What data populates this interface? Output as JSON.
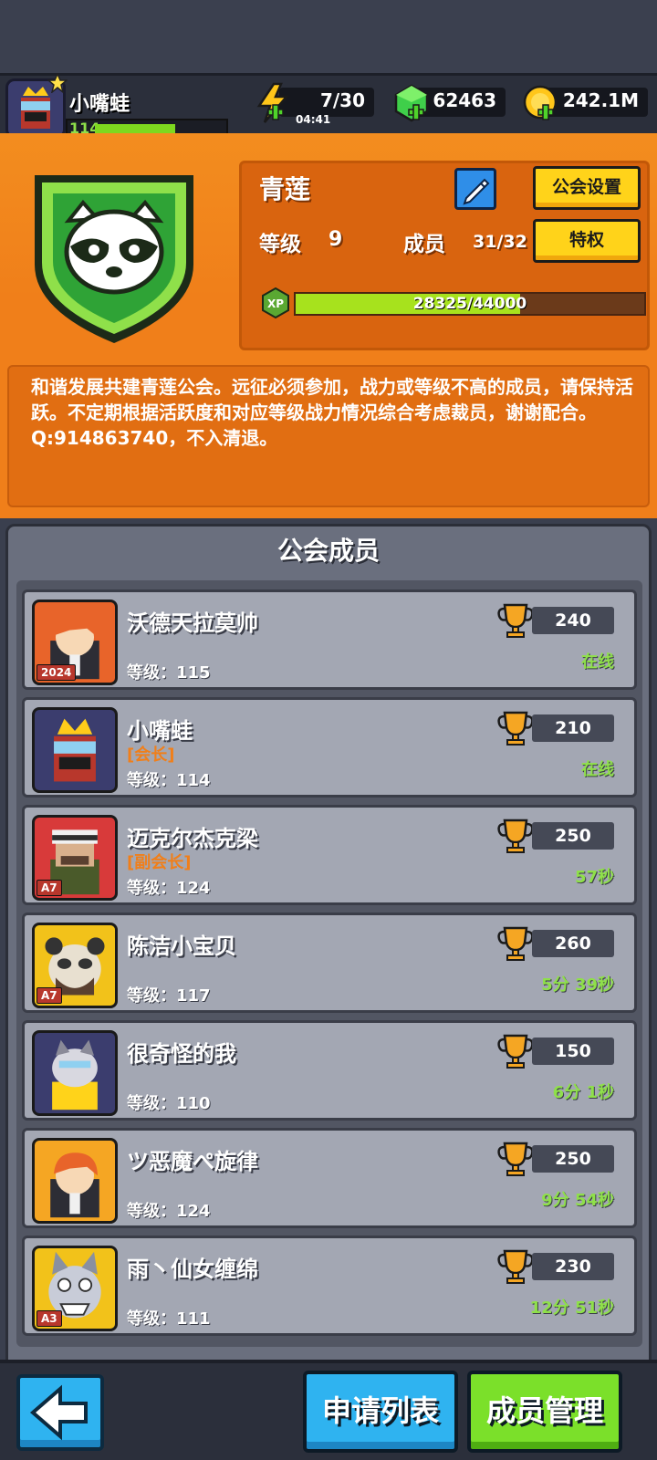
{
  "player": {
    "name": "小嘴蛙",
    "level": "114"
  },
  "resources": {
    "energy": "7/30",
    "energy_timer": "04:41",
    "gems": "62463",
    "coins": "242.1M"
  },
  "guild": {
    "name": "青莲",
    "settings_label": "公会设置",
    "privilege_label": "特权",
    "level_label": "等级",
    "level_value": "9",
    "members_label": "成员",
    "members_value": "31/32",
    "xp_badge": "XP",
    "xp_text": "28325/44000",
    "xp_fraction": 0.6437,
    "description": "和谐发展共建青莲公会。远征必须参加，战力或等级不高的成员，请保持活跃。不定期根据活跃度和对应等级战力情况综合考虑裁员，谢谢配合。Q:914863740，不入清退。"
  },
  "members_title": "公会成员",
  "members": [
    {
      "name": "沃德天拉莫帅",
      "role": "",
      "level": "等级：115",
      "score": "240",
      "status": "在线",
      "badge": "2024",
      "avatar": "red-hair",
      "frame": "#e8642a"
    },
    {
      "name": "小嘴蛙",
      "role": "[会长]",
      "level": "等级：114",
      "score": "210",
      "status": "在线",
      "badge": "",
      "avatar": "crown-ninja",
      "frame": "#3b3d6e"
    },
    {
      "name": "迈克尔杰克梁",
      "role": "[副会长]",
      "level": "等级：124",
      "score": "250",
      "status": "57秒",
      "badge": "A7",
      "avatar": "soldier",
      "frame": "#d83a3a"
    },
    {
      "name": "陈洁小宝贝",
      "role": "",
      "level": "等级：117",
      "score": "260",
      "status": "5分 39秒",
      "badge": "A7",
      "avatar": "panda",
      "frame": "#f2c21a"
    },
    {
      "name": "很奇怪的我",
      "role": "",
      "level": "等级：110",
      "score": "150",
      "status": "6分 1秒",
      "badge": "",
      "avatar": "cat",
      "frame": "#3b3d6e"
    },
    {
      "name": "ツ恶魔ぺ旋律",
      "role": "",
      "level": "等级：124",
      "score": "250",
      "status": "9分 54秒",
      "badge": "",
      "avatar": "red-hair",
      "frame": "#f5a623"
    },
    {
      "name": "雨丶仙女缠绵",
      "role": "",
      "level": "等级：111",
      "score": "230",
      "status": "12分 51秒",
      "badge": "A3",
      "avatar": "wolf",
      "frame": "#f2c21a"
    }
  ],
  "buttons": {
    "apply_list": "申请列表",
    "member_manage": "成员管理"
  }
}
